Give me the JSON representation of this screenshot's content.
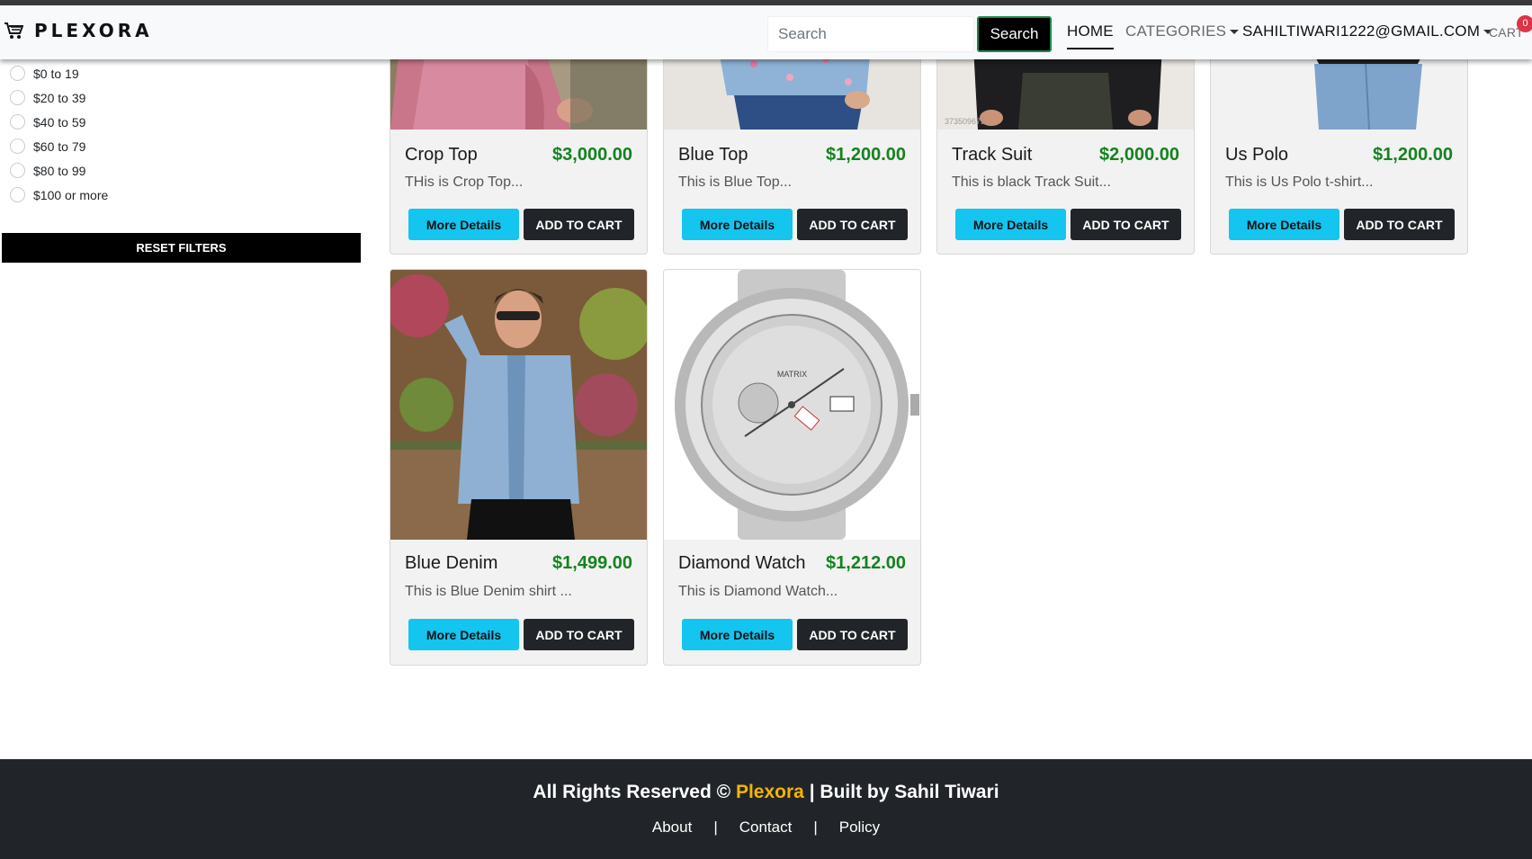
{
  "navbar": {
    "brand": "PLEXORA",
    "search_placeholder": "Search",
    "search_button": "Search",
    "home": "HOME",
    "categories": "CATEGORIES",
    "user": "SAHILTIWARI1222@GMAIL.COM",
    "cart": "CART",
    "cart_count": "0"
  },
  "filters": {
    "price_options": [
      "$0 to 19",
      "$20 to 39",
      "$40 to 59",
      "$60 to 79",
      "$80 to 99",
      "$100 or more"
    ],
    "reset_label": "RESET FILTERS"
  },
  "products": [
    {
      "name": "Crop Top",
      "price": "$3,000.00",
      "description": "THis is Crop Top...",
      "more": "More Details",
      "add": "ADD TO CART"
    },
    {
      "name": "Blue Top",
      "price": "$1,200.00",
      "description": "This is Blue Top...",
      "more": "More Details",
      "add": "ADD TO CART"
    },
    {
      "name": "Track Suit",
      "price": "$2,000.00",
      "description": "This is black Track Suit...",
      "more": "More Details",
      "add": "ADD TO CART",
      "image_text": "373509673"
    },
    {
      "name": "Us Polo",
      "price": "$1,200.00",
      "description": "This is Us Polo t-shirt...",
      "more": "More Details",
      "add": "ADD TO CART"
    },
    {
      "name": "Blue Denim",
      "price": "$1,499.00",
      "description": "This is Blue Denim shirt ...",
      "more": "More Details",
      "add": "ADD TO CART"
    },
    {
      "name": "Diamond Watch",
      "price": "$1,212.00",
      "description": "This is Diamond Watch...",
      "more": "More Details",
      "add": "ADD TO CART",
      "watch_brand": "MATRIX"
    }
  ],
  "footer": {
    "prefix": "All Rights Reserved ©",
    "brand": "Plexora",
    "suffix": "| Built by Sahil Tiwari",
    "links": [
      "About",
      "Contact",
      "Policy"
    ],
    "separator": "|"
  }
}
